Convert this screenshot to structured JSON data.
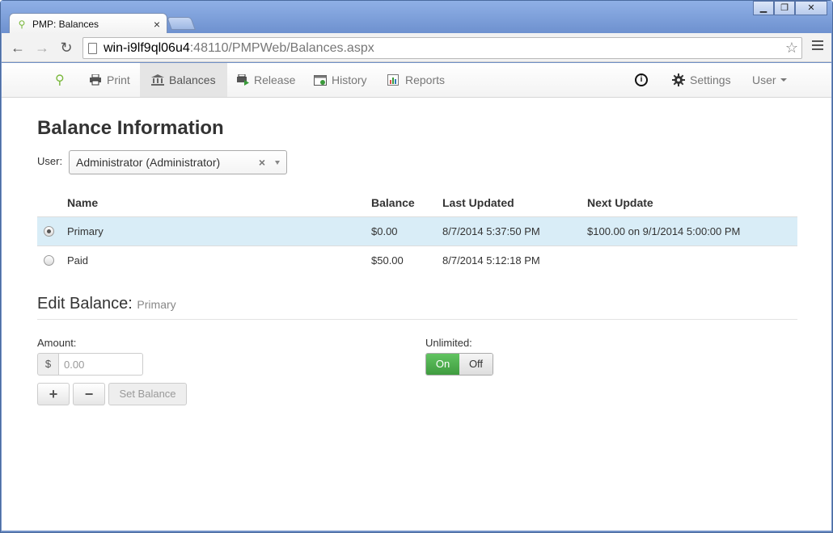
{
  "browser": {
    "tab_title": "PMP: Balances",
    "tab_close": "×",
    "url_host": "win-i9lf9ql06u4",
    "url_rest": ":48110/PMPWeb/Balances.aspx",
    "window_controls": [
      "▁",
      "❐",
      "✕"
    ]
  },
  "nav": {
    "items": [
      {
        "label": "Print"
      },
      {
        "label": "Balances"
      },
      {
        "label": "Release"
      },
      {
        "label": "History"
      },
      {
        "label": "Reports"
      }
    ],
    "info_glyph": "i",
    "settings_label": "Settings",
    "user_label": "User"
  },
  "page": {
    "title": "Balance Information",
    "user_label": "User:",
    "user_select_value": "Administrator (Administrator)",
    "clear_glyph": "×"
  },
  "table": {
    "headers": [
      "Name",
      "Balance",
      "Last Updated",
      "Next Update"
    ],
    "rows": [
      {
        "name": "Primary",
        "balance": "$0.00",
        "last_updated": "8/7/2014 5:37:50 PM",
        "next_update": "$100.00 on 9/1/2014 5:00:00 PM",
        "selected": true
      },
      {
        "name": "Paid",
        "balance": "$50.00",
        "last_updated": "8/7/2014 5:12:18 PM",
        "next_update": "",
        "selected": false
      }
    ]
  },
  "edit": {
    "title": "Edit Balance:",
    "subtitle": "Primary",
    "amount_label": "Amount:",
    "currency": "$",
    "amount_placeholder": "0.00",
    "plus_label": "+",
    "minus_label": "−",
    "set_balance_label": "Set Balance",
    "unlimited_label": "Unlimited:",
    "on_label": "On",
    "off_label": "Off"
  },
  "colors": {
    "selected_row": "#d9edf7",
    "switch_on": "#4cae4c",
    "logo": "#7ab83c"
  }
}
